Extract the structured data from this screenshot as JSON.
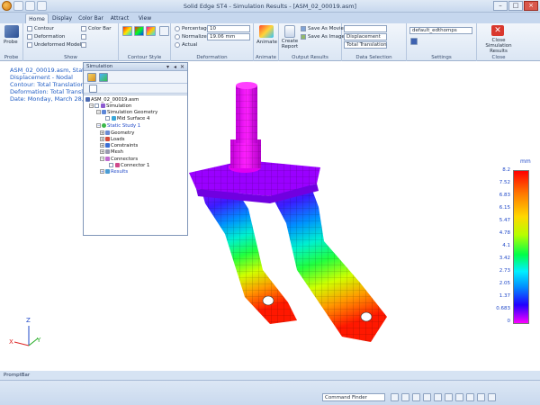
{
  "app": {
    "title": "Solid Edge ST4 - Simulation Results - [ASM_02_00019.asm]"
  },
  "tabs": [
    "Home",
    "Display",
    "Color Bar",
    "Attract",
    "View"
  ],
  "ribbon": {
    "probe": {
      "button": "Probe",
      "group": "Probe"
    },
    "show": {
      "group": "Show",
      "items": [
        "Contour",
        "Deformation",
        "Undeformed Model"
      ],
      "color_bar": "Color Bar"
    },
    "contour_style": {
      "group": "Contour Style"
    },
    "deformation": {
      "group": "Deformation",
      "options": [
        "Percentage",
        "Normalize",
        "Actual"
      ],
      "percentage_value": "10",
      "normalize_value": "19.06 mm"
    },
    "animate": {
      "button": "Animate",
      "group": "Animate"
    },
    "output_results": {
      "group": "Output Results",
      "create_report": "Create Report",
      "save_movie": "Save As Movie",
      "save_image": "Save As Image"
    },
    "data_selection": {
      "group": "Data Selection",
      "result_type": "Displacement",
      "component": "Total Translation"
    },
    "settings": {
      "group": "Settings",
      "preset": "default_edthomps"
    },
    "close": {
      "button": "Close Simulation Results",
      "group": "Close"
    }
  },
  "info": {
    "line1": "ASM_02_00019.asm, Static",
    "line2": "Displacement - Nodal",
    "line3": "Contour: Total Translation",
    "line4": "Deformation: Total Translation",
    "line5": "Date: Monday, March 28, 20"
  },
  "panel": {
    "title": "Simulation",
    "tree": [
      {
        "label": "ASM_02_00019.asm",
        "level": 0
      },
      {
        "label": "Simulation",
        "level": 1
      },
      {
        "label": "Simulation Geometry",
        "level": 2
      },
      {
        "label": "Mid Surface 4",
        "level": 3
      },
      {
        "label": "Static Study 1",
        "level": 2
      },
      {
        "label": "Geometry",
        "level": 3
      },
      {
        "label": "Loads",
        "level": 3
      },
      {
        "label": "Constraints",
        "level": 3
      },
      {
        "label": "Mesh",
        "level": 3
      },
      {
        "label": "Connectors",
        "level": 3
      },
      {
        "label": "Connector 1",
        "level": 4
      },
      {
        "label": "Results",
        "level": 3
      }
    ]
  },
  "legend": {
    "unit": "mm",
    "ticks": [
      "8.2",
      "7.52",
      "6.83",
      "6.15",
      "5.47",
      "4.78",
      "4.1",
      "3.42",
      "2.73",
      "2.05",
      "1.37",
      "0.683",
      "0"
    ]
  },
  "axes": {
    "x": "X",
    "y": "Y",
    "z": "Z"
  },
  "status": {
    "promptbar": "PromptBar",
    "command_finder": "Command Finder"
  }
}
